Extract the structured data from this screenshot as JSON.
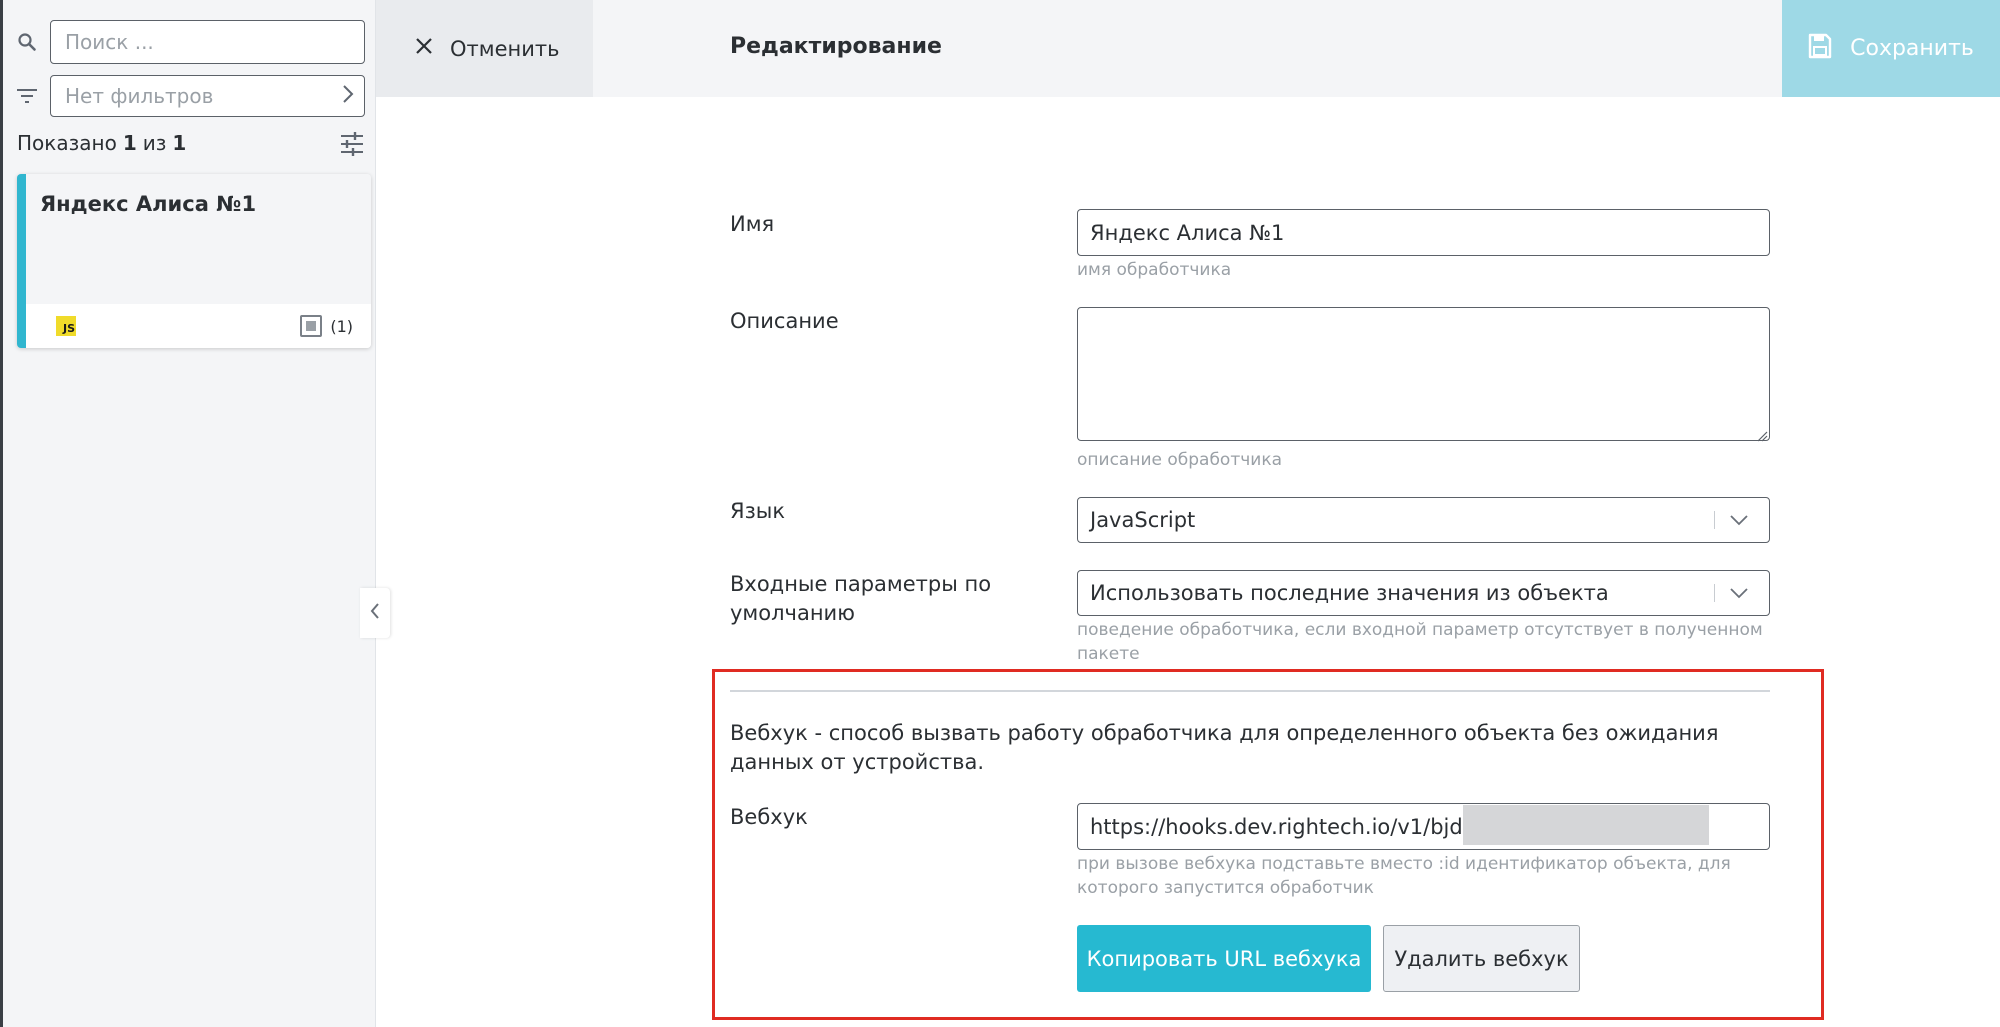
{
  "sidebar": {
    "search_placeholder": "Поиск ...",
    "filter_text": "Нет фильтров",
    "shown_prefix": "Показано",
    "shown_count": "1",
    "shown_of": "из",
    "shown_total": "1",
    "card": {
      "title": "Яндекс Алиса №1",
      "lang_badge": "JS",
      "objects_count": "(1)"
    }
  },
  "header": {
    "cancel_label": "Отменить",
    "title": "Редактирование",
    "save_label": "Сохранить"
  },
  "form": {
    "name": {
      "label": "Имя",
      "value": "Яндекс Алиса №1",
      "hint": "имя обработчика"
    },
    "description": {
      "label": "Описание",
      "value": "",
      "hint": "описание обработчика"
    },
    "language": {
      "label": "Язык",
      "value": "JavaScript"
    },
    "defaults": {
      "label": "Входные параметры по умолчанию",
      "value": "Использовать последние значения из объекта",
      "hint": "поведение обработчика, если входной параметр отсутствует в полученном пакете"
    }
  },
  "webhook": {
    "description": "Вебхук - способ вызвать работу обработчика для определенного объекта без ожидания данных от устройства.",
    "label": "Вебхук",
    "url": "https://hooks.dev.rightech.io/v1/bjdXF",
    "hint": "при вызове вебхука подставьте вместо :id идентификатор объекта, для которого запустится обработчик",
    "copy_label": "Копировать URL вебхука",
    "delete_label": "Удалить вебхук"
  },
  "colors": {
    "accent": "#26b9d1",
    "save_button": "#9ed9e6",
    "card_stripe": "#30b6cf",
    "highlight_border": "#e02b22",
    "js_badge": "#f0db2a"
  }
}
